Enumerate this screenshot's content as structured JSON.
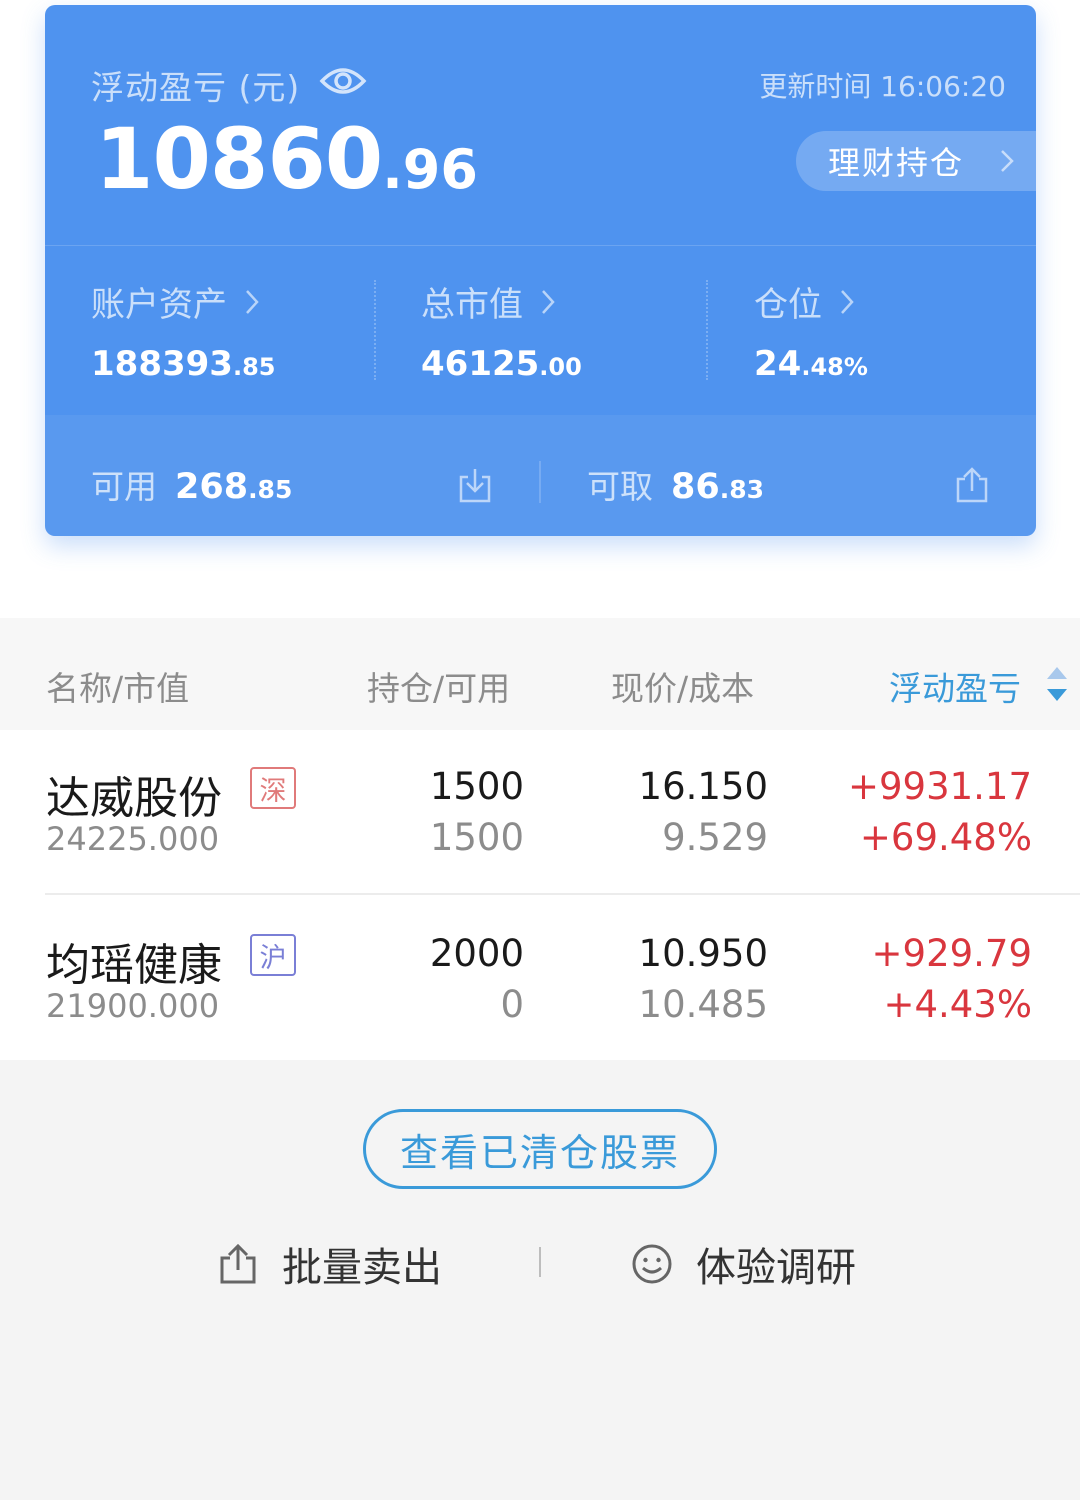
{
  "summary": {
    "title": "浮动盈亏 (元)",
    "update_time": "更新时间 16:06:20",
    "pnl_int": "10860",
    "pnl_dec": ".96",
    "finance_link": "理财持仓",
    "stats": [
      {
        "label": "账户资产",
        "int": "188393",
        "dec": ".85"
      },
      {
        "label": "总市值",
        "int": "46125",
        "dec": ".00"
      },
      {
        "label": "仓位",
        "int": "24",
        "dec": ".48%"
      }
    ],
    "available": {
      "label": "可用",
      "int": "268",
      "dec": ".85"
    },
    "withdrawable": {
      "label": "可取",
      "int": "86",
      "dec": ".83"
    }
  },
  "table": {
    "headers": [
      "名称/市值",
      "持仓/可用",
      "现价/成本",
      "浮动盈亏"
    ],
    "rows": [
      {
        "name": "达威股份",
        "exchange": "深",
        "market_value": "24225.000",
        "position": "1500",
        "available": "1500",
        "price": "16.150",
        "cost": "9.529",
        "pnl": "+9931.17",
        "pnl_pct": "+69.48%"
      },
      {
        "name": "均瑶健康",
        "exchange": "沪",
        "market_value": "21900.000",
        "position": "2000",
        "available": "0",
        "price": "10.950",
        "cost": "10.485",
        "pnl": "+929.79",
        "pnl_pct": "+4.43%"
      }
    ]
  },
  "actions": {
    "cleared_stocks": "查看已清仓股票",
    "batch_sell": "批量卖出",
    "survey": "体验调研"
  },
  "colors": {
    "card_blue": "#4f93ef",
    "accent_blue": "#3a9ad9",
    "gain_red": "#d9363e",
    "tag_sz": "#e07a7a",
    "tag_sh": "#7a7fd6"
  },
  "icons": [
    "eye-icon",
    "chevron-right-icon",
    "download-icon",
    "upload-icon",
    "sort-icon",
    "share-icon",
    "smile-icon"
  ]
}
